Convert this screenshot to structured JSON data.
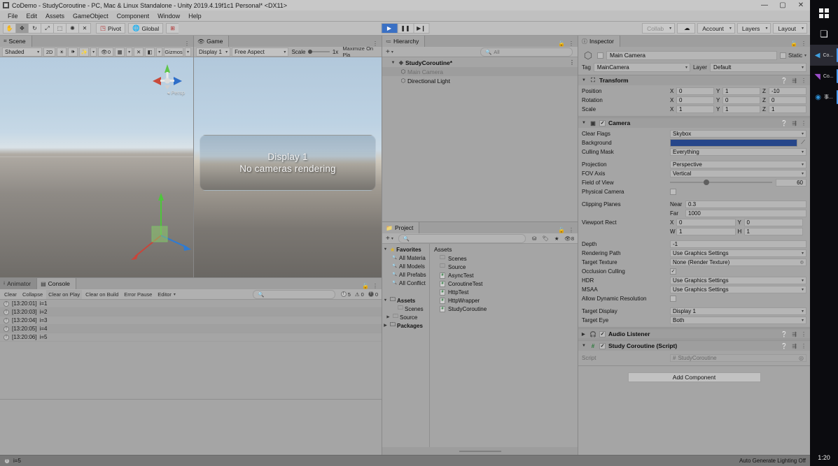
{
  "window": {
    "title": "CoDemo - StudyCoroutine - PC, Mac & Linux Standalone - Unity 2019.4.19f1c1 Personal* <DX11>",
    "minimize": "—",
    "maximize": "▢",
    "close": "✕"
  },
  "menubar": {
    "items": [
      "File",
      "Edit",
      "Assets",
      "GameObject",
      "Component",
      "Window",
      "Help"
    ]
  },
  "toolbar": {
    "transform_tools": [
      {
        "name": "hand-tool",
        "glyph": "✋"
      },
      {
        "name": "move-tool",
        "glyph": "✥"
      },
      {
        "name": "rotate-tool",
        "glyph": "↻"
      },
      {
        "name": "scale-tool",
        "glyph": "⤢"
      },
      {
        "name": "rect-tool",
        "glyph": "⬚"
      },
      {
        "name": "transform-tool",
        "glyph": "✺"
      },
      {
        "name": "custom-tool",
        "glyph": "✕"
      }
    ],
    "pivot_label": "Pivot",
    "global_label": "Global",
    "play_glyph": "▶",
    "pause_glyph": "❚❚",
    "step_glyph": "▶❙",
    "collab_label": "Collab",
    "cloud_glyph": "☁",
    "account_label": "Account",
    "layers_label": "Layers",
    "layout_label": "Layout"
  },
  "scene_panel": {
    "tab_label": "Scene",
    "tab_icon": "scene-icon",
    "draw_mode": "Shaded",
    "two_d_label": "2D",
    "gizmos_label": "Gizmos",
    "light_glyph": "☀",
    "audio_glyph": "🕪",
    "fx_glyph": "✨",
    "scene_vis_count": "0",
    "persp_label": "Persp"
  },
  "game_panel": {
    "tab_label": "Game",
    "display_label": "Display 1",
    "aspect_label": "Free Aspect",
    "scale_label": "Scale",
    "scale_value": "1x",
    "maximize_label": "Maximize On Pla",
    "overlay_line1": "Display 1",
    "overlay_line2": "No cameras rendering"
  },
  "hierarchy_panel": {
    "tab_label": "Hierarchy",
    "add_label": "+",
    "search_placeholder": "All",
    "rows": [
      {
        "label": "StudyCoroutine*",
        "indent": 0,
        "type": "scene",
        "selected": false,
        "expanded": true
      },
      {
        "label": "Main Camera",
        "indent": 1,
        "type": "gameobject",
        "selected": true,
        "expanded": false
      },
      {
        "label": "Directional Light",
        "indent": 1,
        "type": "gameobject",
        "selected": false,
        "expanded": false
      }
    ]
  },
  "project_panel": {
    "tab_label": "Project",
    "search_placeholder": "",
    "tree": [
      {
        "label": "Favorites",
        "indent": 0,
        "icon": "star-icon",
        "head": true,
        "expanded": true
      },
      {
        "label": "All Materia",
        "indent": 1,
        "icon": "search-icon",
        "head": false
      },
      {
        "label": "All Models",
        "indent": 1,
        "icon": "search-icon",
        "head": false
      },
      {
        "label": "All Prefabs",
        "indent": 1,
        "icon": "search-icon",
        "head": false
      },
      {
        "label": "All Conflict",
        "indent": 1,
        "icon": "search-icon",
        "head": false
      },
      {
        "label": "",
        "indent": 0,
        "icon": "",
        "head": false
      },
      {
        "label": "Assets",
        "indent": 0,
        "icon": "folder-icon",
        "head": true,
        "expanded": true
      },
      {
        "label": "Scenes",
        "indent": 1,
        "icon": "folder-icon",
        "head": false
      },
      {
        "label": "Source",
        "indent": 1,
        "icon": "folder-icon",
        "head": false,
        "collapsed": true
      },
      {
        "label": "Packages",
        "indent": 0,
        "icon": "folder-icon",
        "head": true,
        "collapsed": true
      }
    ],
    "breadcrumb": "Assets",
    "items": [
      {
        "label": "Scenes",
        "type": "folder"
      },
      {
        "label": "Source",
        "type": "folder"
      },
      {
        "label": "AsyncTest",
        "type": "script"
      },
      {
        "label": "CoroutineTest",
        "type": "script"
      },
      {
        "label": "HttpTest",
        "type": "script"
      },
      {
        "label": "HttpWrapper",
        "type": "script"
      },
      {
        "label": "StudyCoroutine",
        "type": "script"
      }
    ]
  },
  "console_panel": {
    "tabs": [
      {
        "label": "Animator",
        "icon": "animator-icon",
        "active": false
      },
      {
        "label": "Console",
        "icon": "console-icon",
        "active": true
      }
    ],
    "buttons": [
      "Clear",
      "Collapse",
      "Clear on Play",
      "Clear on Build",
      "Error Pause"
    ],
    "editor_label": "Editor",
    "search_placeholder": "",
    "counts": {
      "info": "5",
      "warning": "0",
      "error": "0"
    },
    "logs": [
      {
        "time": "[13:20:01]",
        "message": "i=1",
        "level": "info"
      },
      {
        "time": "[13:20:03]",
        "message": "i=2",
        "level": "info"
      },
      {
        "time": "[13:20:04]",
        "message": "i=3",
        "level": "info"
      },
      {
        "time": "[13:20:05]",
        "message": "i=4",
        "level": "info"
      },
      {
        "time": "[13:20:06]",
        "message": "i=5",
        "level": "info"
      }
    ]
  },
  "inspector_panel": {
    "tab_label": "Inspector",
    "object_name": "Main Camera",
    "static_label": "Static",
    "tag_label": "Tag",
    "tag_value": "MainCamera",
    "layer_label": "Layer",
    "layer_value": "Default",
    "components": [
      {
        "name": "Transform",
        "icon": "transform-icon",
        "enabled": null,
        "rows": [
          {
            "label": "Position",
            "type": "vector3",
            "x": "0",
            "y": "1",
            "z": "-10"
          },
          {
            "label": "Rotation",
            "type": "vector3",
            "x": "0",
            "y": "0",
            "z": "0"
          },
          {
            "label": "Scale",
            "type": "vector3",
            "x": "1",
            "y": "1",
            "z": "1"
          }
        ]
      },
      {
        "name": "Camera",
        "icon": "camera-icon",
        "enabled": true,
        "rows": [
          {
            "label": "Clear Flags",
            "type": "dropdown",
            "value": "Skybox"
          },
          {
            "label": "Background",
            "type": "color",
            "value": "#26468a"
          },
          {
            "label": "Culling Mask",
            "type": "dropdown",
            "value": "Everything"
          },
          {
            "label": "",
            "type": "gap"
          },
          {
            "label": "Projection",
            "type": "dropdown",
            "value": "Perspective"
          },
          {
            "label": "FOV Axis",
            "type": "dropdown",
            "value": "Vertical"
          },
          {
            "label": "Field of View",
            "type": "slider",
            "value": "60",
            "percent": 33
          },
          {
            "label": "Physical Camera",
            "type": "checkbox",
            "checked": false
          },
          {
            "label": "",
            "type": "gap"
          },
          {
            "label": "Clipping Planes",
            "type": "pair",
            "sub1": "Near",
            "val1": "0.3",
            "sub2": "Far",
            "val2": "1000"
          },
          {
            "label": "Viewport Rect",
            "type": "rect",
            "ax": "X",
            "vx": "0",
            "ay": "Y",
            "vy": "0",
            "aw": "W",
            "vw": "1",
            "ah": "H",
            "vh": "1"
          },
          {
            "label": "",
            "type": "gap"
          },
          {
            "label": "Depth",
            "type": "field",
            "value": "-1"
          },
          {
            "label": "Rendering Path",
            "type": "dropdown",
            "value": "Use Graphics Settings"
          },
          {
            "label": "Target Texture",
            "type": "objfield",
            "value": "None (Render Texture)"
          },
          {
            "label": "Occlusion Culling",
            "type": "checkbox",
            "checked": true
          },
          {
            "label": "HDR",
            "type": "dropdown",
            "value": "Use Graphics Settings"
          },
          {
            "label": "MSAA",
            "type": "dropdown",
            "value": "Use Graphics Settings"
          },
          {
            "label": "Allow Dynamic Resolution",
            "type": "checkbox",
            "checked": false
          },
          {
            "label": "",
            "type": "gap"
          },
          {
            "label": "Target Display",
            "type": "dropdown",
            "value": "Display 1"
          },
          {
            "label": "Target Eye",
            "type": "dropdown",
            "value": "Both"
          }
        ]
      },
      {
        "name": "Audio Listener",
        "icon": "audio-icon",
        "enabled": true,
        "rows": []
      },
      {
        "name": "Study Coroutine (Script)",
        "icon": "script-icon",
        "enabled": true,
        "rows": [
          {
            "label": "Script",
            "type": "script",
            "value": "StudyCoroutine"
          }
        ]
      }
    ],
    "add_component_label": "Add Component"
  },
  "statusbar": {
    "message": "i=5",
    "right_message": "Auto Generate Lighting Off"
  },
  "taskbar": {
    "start_label": "start-icon",
    "taskview_label": "task-view-icon",
    "apps": [
      {
        "label": "Co...",
        "icon": "vscode-icon",
        "running": true,
        "active": true
      },
      {
        "label": "Co...",
        "icon": "visualstudio-icon",
        "running": true,
        "active": false
      },
      {
        "label": "事...",
        "icon": "browser-icon",
        "running": true,
        "active": false
      }
    ],
    "clock": "1:20"
  }
}
